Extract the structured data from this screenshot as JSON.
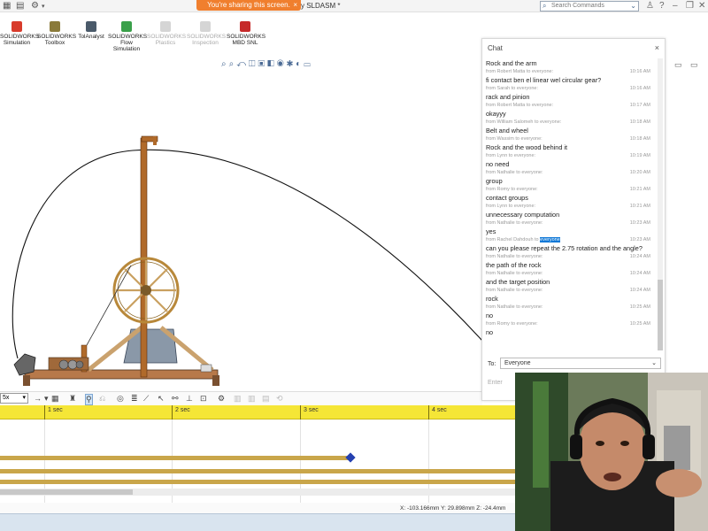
{
  "titlebar": {
    "share_banner": "You're sharing this screen.",
    "share_close": "×",
    "doc_title": "y SLDASM *",
    "search_placeholder": "Search Commands",
    "help_glyph": "?",
    "minimize_glyph": "–",
    "restore_glyph": "❐",
    "close_glyph": "✕"
  },
  "commands": [
    {
      "label1": "SOLIDWORKS",
      "label2": "Simulation",
      "label3": "",
      "enabled": true,
      "color": "#d83b2b"
    },
    {
      "label1": "SOLIDWORKS",
      "label2": "Toolbox",
      "label3": "",
      "enabled": true,
      "color": "#8a7a3a"
    },
    {
      "label1": "TolAnalyst",
      "label2": "",
      "label3": "",
      "enabled": true,
      "color": "#4a5a6a"
    },
    {
      "label1": "SOLIDWORKS",
      "label2": "Flow",
      "label3": "Simulation",
      "enabled": true,
      "color": "#3aa04a"
    },
    {
      "label1": "SOLIDWORKS",
      "label2": "Plastics",
      "label3": "",
      "enabled": false,
      "color": "#c9c9c9"
    },
    {
      "label1": "SOLIDWORKS",
      "label2": "Inspection",
      "label3": "",
      "enabled": false,
      "color": "#c9c9c9"
    },
    {
      "label1": "SOLIDWORKS",
      "label2": "MBD SNL",
      "label3": "",
      "enabled": true,
      "color": "#c62a2a"
    }
  ],
  "anim": {
    "speed_value": "5x",
    "speed_dropdown_glyph": "▾"
  },
  "timeline": {
    "marks": [
      "1 sec",
      "2 sec",
      "3 sec",
      "4 sec"
    ]
  },
  "status": {
    "coords": "X: -103.166mm  Y: 29.898mm  Z: -24.4mm"
  },
  "chat": {
    "title": "Chat",
    "close_glyph": "×",
    "messages": [
      {
        "meta": "",
        "time": "",
        "text": "Rock and the arm"
      },
      {
        "meta": "from Robert Matta to everyone:",
        "time": "10:16 AM",
        "text": "fi contact ben el linear wel circular gear?"
      },
      {
        "meta": "from Sarah to everyone:",
        "time": "10:16 AM",
        "text": "rack and pinion"
      },
      {
        "meta": "from Robert Matta to everyone:",
        "time": "10:17 AM",
        "text": "okayyy"
      },
      {
        "meta": "from William Salomeh to everyone:",
        "time": "10:18 AM",
        "text": "Belt and wheel"
      },
      {
        "meta": "from Wassim to everyone:",
        "time": "10:18 AM",
        "text": "Rock and the wood behind it"
      },
      {
        "meta": "from Lynn to everyone:",
        "time": "10:19 AM",
        "text": "no need"
      },
      {
        "meta": "from Nathalie to everyone:",
        "time": "10:20 AM",
        "text": "group"
      },
      {
        "meta": "from Romy to everyone:",
        "time": "10:21 AM",
        "text": "contact groups"
      },
      {
        "meta": "from Lynn to everyone:",
        "time": "10:21 AM",
        "text": "unnecessary computation"
      },
      {
        "meta": "from Nathalie to everyone:",
        "time": "10:23 AM",
        "text": "yes"
      },
      {
        "meta_prefix": "from Rachel Dahdouh to",
        "meta_highlight": "everyone",
        "time": "10:23 AM",
        "text": "can you please repeat the 2.75 rotation and the angle?"
      },
      {
        "meta": "from Nathalie to everyone:",
        "time": "10:24 AM",
        "text": "the path of the rock"
      },
      {
        "meta": "from Nathalie to everyone:",
        "time": "10:24 AM",
        "text": "and the target position"
      },
      {
        "meta": "from Nathalie to everyone:",
        "time": "10:24 AM",
        "text": "rock"
      },
      {
        "meta": "from Nathalie to everyone:",
        "time": "10:25 AM",
        "text": "no"
      },
      {
        "meta": "from Romy to everyone:",
        "time": "10:25 AM",
        "text": "no"
      }
    ],
    "to_label": "To:",
    "to_value": "Everyone",
    "input_placeholder": "Enter"
  }
}
